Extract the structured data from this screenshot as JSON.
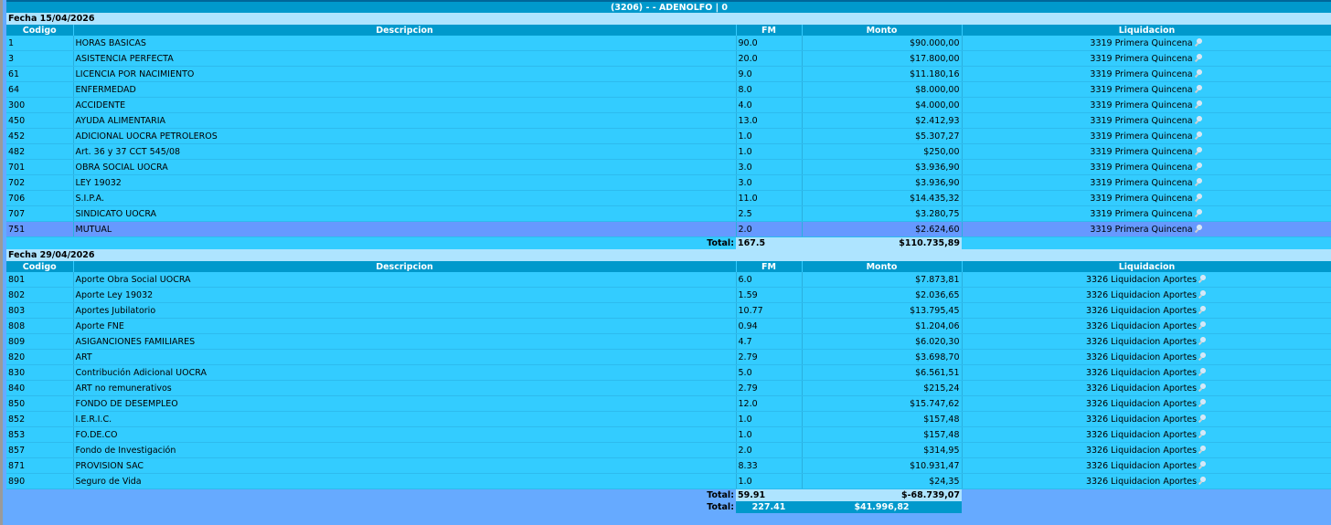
{
  "header": {
    "title": "(3206) - - ADENOLFO | 0"
  },
  "columns": {
    "codigo": "Codigo",
    "descripcion": "Descripcion",
    "fm": "FM",
    "monto": "Monto",
    "liquidacion": "Liquidacion"
  },
  "sections": [
    {
      "date_label": "Fecha 15/04/2026",
      "rows": [
        {
          "codigo": "1",
          "descripcion": "HORAS BASICAS",
          "fm": "90.0",
          "monto": "$90.000,00",
          "liquidacion": "3319 Primera Quincena"
        },
        {
          "codigo": "3",
          "descripcion": "ASISTENCIA PERFECTA",
          "fm": "20.0",
          "monto": "$17.800,00",
          "liquidacion": "3319 Primera Quincena"
        },
        {
          "codigo": "61",
          "descripcion": "LICENCIA POR NACIMIENTO",
          "fm": "9.0",
          "monto": "$11.180,16",
          "liquidacion": "3319 Primera Quincena"
        },
        {
          "codigo": "64",
          "descripcion": "ENFERMEDAD",
          "fm": "8.0",
          "monto": "$8.000,00",
          "liquidacion": "3319 Primera Quincena"
        },
        {
          "codigo": "300",
          "descripcion": "ACCIDENTE",
          "fm": "4.0",
          "monto": "$4.000,00",
          "liquidacion": "3319 Primera Quincena"
        },
        {
          "codigo": "450",
          "descripcion": "AYUDA ALIMENTARIA",
          "fm": "13.0",
          "monto": "$2.412,93",
          "liquidacion": "3319 Primera Quincena"
        },
        {
          "codigo": "452",
          "descripcion": "ADICIONAL UOCRA PETROLEROS",
          "fm": "1.0",
          "monto": "$5.307,27",
          "liquidacion": "3319 Primera Quincena"
        },
        {
          "codigo": "482",
          "descripcion": "Art. 36 y 37 CCT 545/08",
          "fm": "1.0",
          "monto": "$250,00",
          "liquidacion": "3319 Primera Quincena"
        },
        {
          "codigo": "701",
          "descripcion": "OBRA SOCIAL UOCRA",
          "fm": "3.0",
          "monto": "$3.936,90",
          "liquidacion": "3319 Primera Quincena"
        },
        {
          "codigo": "702",
          "descripcion": "LEY 19032",
          "fm": "3.0",
          "monto": "$3.936,90",
          "liquidacion": "3319 Primera Quincena"
        },
        {
          "codigo": "706",
          "descripcion": "S.I.P.A.",
          "fm": "11.0",
          "monto": "$14.435,32",
          "liquidacion": "3319 Primera Quincena"
        },
        {
          "codigo": "707",
          "descripcion": "SINDICATO UOCRA",
          "fm": "2.5",
          "monto": "$3.280,75",
          "liquidacion": "3319 Primera Quincena"
        },
        {
          "codigo": "751",
          "descripcion": "MUTUAL",
          "fm": "2.0",
          "monto": "$2.624,60",
          "liquidacion": "3319 Primera Quincena"
        }
      ],
      "total_label": "Total:",
      "total_fm": "167.5",
      "total_monto": "$110.735,89"
    },
    {
      "date_label": "Fecha 29/04/2026",
      "rows": [
        {
          "codigo": "801",
          "descripcion": "Aporte Obra Social UOCRA",
          "fm": "6.0",
          "monto": "$7.873,81",
          "liquidacion": "3326 Liquidacion Aportes"
        },
        {
          "codigo": "802",
          "descripcion": "Aporte Ley 19032",
          "fm": "1.59",
          "monto": "$2.036,65",
          "liquidacion": "3326 Liquidacion Aportes"
        },
        {
          "codigo": "803",
          "descripcion": "Aportes Jubilatorio",
          "fm": "10.77",
          "monto": "$13.795,45",
          "liquidacion": "3326 Liquidacion Aportes"
        },
        {
          "codigo": "808",
          "descripcion": "Aporte FNE",
          "fm": "0.94",
          "monto": "$1.204,06",
          "liquidacion": "3326 Liquidacion Aportes"
        },
        {
          "codigo": "809",
          "descripcion": "ASIGANCIONES FAMILIARES",
          "fm": "4.7",
          "monto": "$6.020,30",
          "liquidacion": "3326 Liquidacion Aportes"
        },
        {
          "codigo": "820",
          "descripcion": "ART",
          "fm": "2.79",
          "monto": "$3.698,70",
          "liquidacion": "3326 Liquidacion Aportes"
        },
        {
          "codigo": "830",
          "descripcion": "Contribución Adicional UOCRA",
          "fm": "5.0",
          "monto": "$6.561,51",
          "liquidacion": "3326 Liquidacion Aportes"
        },
        {
          "codigo": "840",
          "descripcion": "ART no remunerativos",
          "fm": "2.79",
          "monto": "$215,24",
          "liquidacion": "3326 Liquidacion Aportes"
        },
        {
          "codigo": "850",
          "descripcion": "FONDO DE DESEMPLEO",
          "fm": "12.0",
          "monto": "$15.747,62",
          "liquidacion": "3326 Liquidacion Aportes"
        },
        {
          "codigo": "852",
          "descripcion": "I.E.R.I.C.",
          "fm": "1.0",
          "monto": "$157,48",
          "liquidacion": "3326 Liquidacion Aportes"
        },
        {
          "codigo": "853",
          "descripcion": "FO.DE.CO",
          "fm": "1.0",
          "monto": "$157,48",
          "liquidacion": "3326 Liquidacion Aportes"
        },
        {
          "codigo": "857",
          "descripcion": "Fondo de Investigación",
          "fm": "2.0",
          "monto": "$314,95",
          "liquidacion": "3326 Liquidacion Aportes"
        },
        {
          "codigo": "871",
          "descripcion": "PROVISION SAC",
          "fm": "8.33",
          "monto": "$10.931,47",
          "liquidacion": "3326 Liquidacion Aportes"
        },
        {
          "codigo": "890",
          "descripcion": "Seguro de Vida",
          "fm": "1.0",
          "monto": "$24,35",
          "liquidacion": "3326 Liquidacion Aportes"
        }
      ],
      "total_label": "Total:",
      "total_fm": "59.91",
      "total_monto": "$-68.739,07"
    }
  ],
  "grand_total": {
    "label": "Total:",
    "fm": "227.41",
    "monto": "$41.996,82"
  },
  "highlight_row": {
    "section": 0,
    "index": 12
  },
  "colors": {
    "header_bg": "#0099cc",
    "row_bg": "#33ccff",
    "date_bg": "#aee4ff",
    "highlight_bg": "#6699ff",
    "page_bg": "#66aaff"
  },
  "icons": {
    "liquidacion_row_icon": "magnifier-icon"
  }
}
